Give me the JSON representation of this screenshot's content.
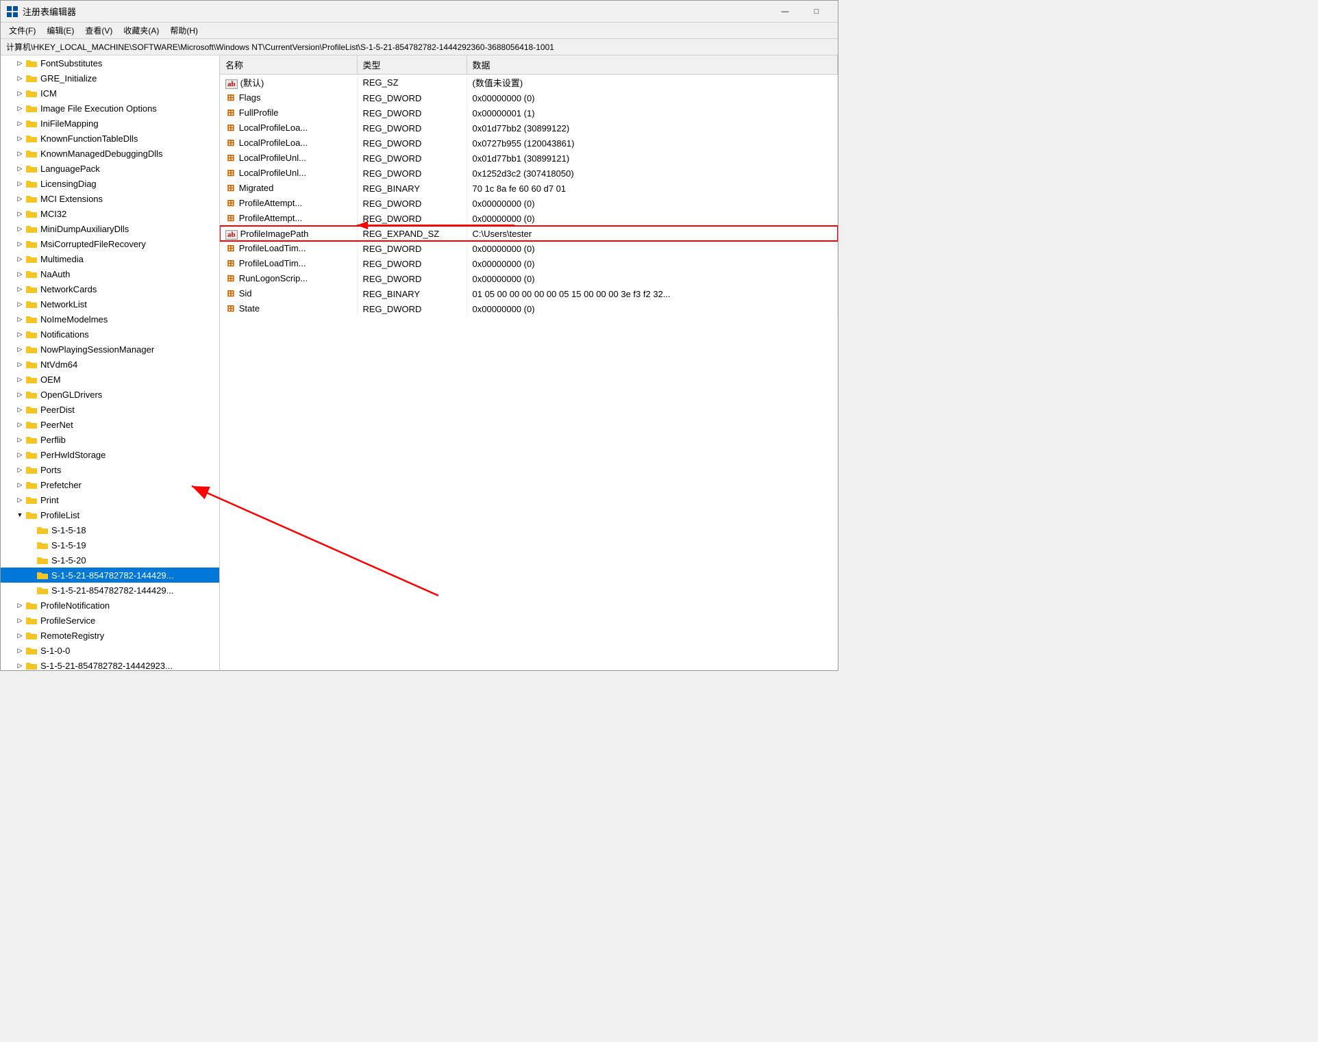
{
  "titlebar": {
    "title": "注册表编辑器",
    "minimize": "—",
    "maximize": "□"
  },
  "menubar": {
    "items": [
      "文件(F)",
      "编辑(E)",
      "查看(V)",
      "收藏夹(A)",
      "帮助(H)"
    ]
  },
  "breadcrumb": "计算机\\HKEY_LOCAL_MACHINE\\SOFTWARE\\Microsoft\\Windows NT\\CurrentVersion\\ProfileList\\S-1-5-21-854782782-1444292360-3688056418-1001",
  "tree": {
    "items": [
      {
        "label": "FontSubstitutes",
        "indent": 1,
        "expanded": false,
        "selected": false,
        "icon": "folder"
      },
      {
        "label": "GRE_Initialize",
        "indent": 1,
        "expanded": false,
        "selected": false,
        "icon": "folder"
      },
      {
        "label": "ICM",
        "indent": 1,
        "expanded": false,
        "selected": false,
        "icon": "folder"
      },
      {
        "label": "Image File Execution Options",
        "indent": 1,
        "expanded": false,
        "selected": false,
        "icon": "folder"
      },
      {
        "label": "IniFileMapping",
        "indent": 1,
        "expanded": false,
        "selected": false,
        "icon": "folder"
      },
      {
        "label": "KnownFunctionTableDlls",
        "indent": 1,
        "expanded": false,
        "selected": false,
        "icon": "folder"
      },
      {
        "label": "KnownManagedDebuggingDlls",
        "indent": 1,
        "expanded": false,
        "selected": false,
        "icon": "folder"
      },
      {
        "label": "LanguagePack",
        "indent": 1,
        "expanded": false,
        "selected": false,
        "icon": "folder"
      },
      {
        "label": "LicensingDiag",
        "indent": 1,
        "expanded": false,
        "selected": false,
        "icon": "folder"
      },
      {
        "label": "MCI Extensions",
        "indent": 1,
        "expanded": false,
        "selected": false,
        "icon": "folder"
      },
      {
        "label": "MCI32",
        "indent": 1,
        "expanded": false,
        "selected": false,
        "icon": "folder"
      },
      {
        "label": "MiniDumpAuxiliaryDlls",
        "indent": 1,
        "expanded": false,
        "selected": false,
        "icon": "folder"
      },
      {
        "label": "MsiCorruptedFileRecovery",
        "indent": 1,
        "expanded": false,
        "selected": false,
        "icon": "folder"
      },
      {
        "label": "Multimedia",
        "indent": 1,
        "expanded": false,
        "selected": false,
        "icon": "folder"
      },
      {
        "label": "NaAuth",
        "indent": 1,
        "expanded": false,
        "selected": false,
        "icon": "folder"
      },
      {
        "label": "NetworkCards",
        "indent": 1,
        "expanded": false,
        "selected": false,
        "icon": "folder"
      },
      {
        "label": "NetworkList",
        "indent": 1,
        "expanded": false,
        "selected": false,
        "icon": "folder"
      },
      {
        "label": "NoImeModelmes",
        "indent": 1,
        "expanded": false,
        "selected": false,
        "icon": "folder"
      },
      {
        "label": "Notifications",
        "indent": 1,
        "expanded": false,
        "selected": false,
        "icon": "folder"
      },
      {
        "label": "NowPlayingSessionManager",
        "indent": 1,
        "expanded": false,
        "selected": false,
        "icon": "folder"
      },
      {
        "label": "NtVdm64",
        "indent": 1,
        "expanded": false,
        "selected": false,
        "icon": "folder"
      },
      {
        "label": "OEM",
        "indent": 1,
        "expanded": false,
        "selected": false,
        "icon": "folder"
      },
      {
        "label": "OpenGLDrivers",
        "indent": 1,
        "expanded": false,
        "selected": false,
        "icon": "folder"
      },
      {
        "label": "PeerDist",
        "indent": 1,
        "expanded": false,
        "selected": false,
        "icon": "folder"
      },
      {
        "label": "PeerNet",
        "indent": 1,
        "expanded": false,
        "selected": false,
        "icon": "folder"
      },
      {
        "label": "Perflib",
        "indent": 1,
        "expanded": false,
        "selected": false,
        "icon": "folder"
      },
      {
        "label": "PerHwIdStorage",
        "indent": 1,
        "expanded": false,
        "selected": false,
        "icon": "folder"
      },
      {
        "label": "Ports",
        "indent": 1,
        "expanded": false,
        "selected": false,
        "icon": "folder"
      },
      {
        "label": "Prefetcher",
        "indent": 1,
        "expanded": false,
        "selected": false,
        "icon": "folder"
      },
      {
        "label": "Print",
        "indent": 1,
        "expanded": false,
        "selected": false,
        "icon": "folder"
      },
      {
        "label": "ProfileList",
        "indent": 1,
        "expanded": true,
        "selected": false,
        "icon": "folder"
      },
      {
        "label": "S-1-5-18",
        "indent": 2,
        "expanded": false,
        "selected": false,
        "icon": "folder-small"
      },
      {
        "label": "S-1-5-19",
        "indent": 2,
        "expanded": false,
        "selected": false,
        "icon": "folder-small"
      },
      {
        "label": "S-1-5-20",
        "indent": 2,
        "expanded": false,
        "selected": false,
        "icon": "folder-small"
      },
      {
        "label": "S-1-5-21-854782782-144429...",
        "indent": 2,
        "expanded": false,
        "selected": true,
        "icon": "folder-small"
      },
      {
        "label": "S-1-5-21-854782782-144429...",
        "indent": 2,
        "expanded": false,
        "selected": false,
        "icon": "folder-small"
      },
      {
        "label": "ProfileNotification",
        "indent": 1,
        "expanded": false,
        "selected": false,
        "icon": "folder"
      },
      {
        "label": "ProfileService",
        "indent": 1,
        "expanded": false,
        "selected": false,
        "icon": "folder"
      },
      {
        "label": "RemoteRegistry",
        "indent": 1,
        "expanded": false,
        "selected": false,
        "icon": "folder"
      },
      {
        "label": "S-1-0-0",
        "indent": 1,
        "expanded": false,
        "selected": false,
        "icon": "folder"
      },
      {
        "label": "S-1-5-21-854782782-14442923...",
        "indent": 1,
        "expanded": false,
        "selected": false,
        "icon": "folder"
      }
    ]
  },
  "columns": {
    "name": "名称",
    "type": "类型",
    "data": "数据"
  },
  "registry_entries": [
    {
      "name": "(默认)",
      "type": "REG_SZ",
      "data": "(数值未设置)",
      "icon": "ab",
      "highlight": false
    },
    {
      "name": "Flags",
      "type": "REG_DWORD",
      "data": "0x00000000 (0)",
      "icon": "dword",
      "highlight": false
    },
    {
      "name": "FullProfile",
      "type": "REG_DWORD",
      "data": "0x00000001 (1)",
      "icon": "dword",
      "highlight": false
    },
    {
      "name": "LocalProfileLoa...",
      "type": "REG_DWORD",
      "data": "0x01d77bb2 (30899122)",
      "icon": "dword",
      "highlight": false
    },
    {
      "name": "LocalProfileLoa...",
      "type": "REG_DWORD",
      "data": "0x0727b955 (120043861)",
      "icon": "dword",
      "highlight": false
    },
    {
      "name": "LocalProfileUnl...",
      "type": "REG_DWORD",
      "data": "0x01d77bb1 (30899121)",
      "icon": "dword",
      "highlight": false
    },
    {
      "name": "LocalProfileUnl...",
      "type": "REG_DWORD",
      "data": "0x1252d3c2 (307418050)",
      "icon": "dword",
      "highlight": false
    },
    {
      "name": "Migrated",
      "type": "REG_BINARY",
      "data": "70 1c 8a fe 60 60 d7 01",
      "icon": "dword",
      "highlight": false
    },
    {
      "name": "ProfileAttempt...",
      "type": "REG_DWORD",
      "data": "0x00000000 (0)",
      "icon": "dword",
      "highlight": false
    },
    {
      "name": "ProfileAttempt...",
      "type": "REG_DWORD",
      "data": "0x00000000 (0)",
      "icon": "dword",
      "highlight": false
    },
    {
      "name": "ProfileImagePath",
      "type": "REG_EXPAND_SZ",
      "data": "C:\\Users\\tester",
      "icon": "ab",
      "highlight": true
    },
    {
      "name": "ProfileLoadTim...",
      "type": "REG_DWORD",
      "data": "0x00000000 (0)",
      "icon": "dword",
      "highlight": false
    },
    {
      "name": "ProfileLoadTim...",
      "type": "REG_DWORD",
      "data": "0x00000000 (0)",
      "icon": "dword",
      "highlight": false
    },
    {
      "name": "RunLogonScrip...",
      "type": "REG_DWORD",
      "data": "0x00000000 (0)",
      "icon": "dword",
      "highlight": false
    },
    {
      "name": "Sid",
      "type": "REG_BINARY",
      "data": "01 05 00 00 00 00 00 05 15 00 00 00 3e f3 f2 32...",
      "icon": "dword",
      "highlight": false
    },
    {
      "name": "State",
      "type": "REG_DWORD",
      "data": "0x00000000 (0)",
      "icon": "dword",
      "highlight": false
    }
  ]
}
